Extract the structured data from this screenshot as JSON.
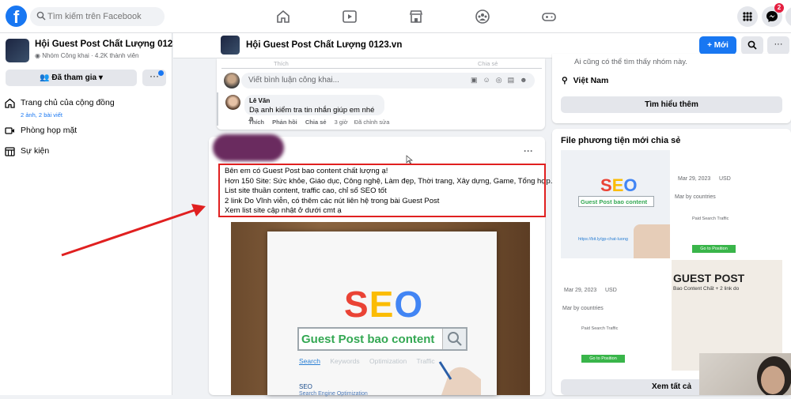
{
  "topbar": {
    "logo": "f",
    "search_placeholder": "Tìm kiếm trên Facebook",
    "nav_icons": [
      "home-icon",
      "video-icon",
      "marketplace-icon",
      "groups-icon",
      "gaming-icon"
    ],
    "menu_icon": "grid-menu-icon",
    "messenger_icon": "messenger-icon",
    "notification_count": "2"
  },
  "left": {
    "group_name": "Hội Guest Post Chất Lượng 0123.vn",
    "group_meta": "Nhóm Công khai · 4.2K thành viên",
    "joined_label": "Đã tham gia",
    "more_label": "···",
    "nav": [
      {
        "label": "Trang chủ của cộng đồng",
        "sub": "2 ảnh, 2 bài viết"
      },
      {
        "label": "Phòng họp mặt",
        "sub": ""
      },
      {
        "label": "Sự kiện",
        "sub": ""
      }
    ]
  },
  "header": {
    "title": "Hội Guest Post Chất Lượng 0123.vn",
    "new_button": "Mới",
    "search_icon": "search-icon",
    "more_label": "···"
  },
  "comments": {
    "ghost_left": "Thích",
    "ghost_right": "Chia sẻ",
    "input_placeholder": "Viết bình luận công khai...",
    "author": "Lê Văn",
    "text": "Dạ anh kiểm tra tin nhắn giúp em nhé ạ",
    "actions": [
      "Thích",
      "Phản hồi",
      "Chia sẻ",
      "3 giờ",
      "Đã chỉnh sửa"
    ]
  },
  "post": {
    "lines": [
      "Bên em có Guest Post bao content chất lượng ạ!",
      "Hơn 150 Site: Sức khỏe, Giáo dục, Công nghệ, Làm đẹp, Thời trang, Xây dựng, Game, Tổng hợp...",
      "List site thuần content, traffic cao, chỉ số SEO tốt",
      "2 link Do Vĩnh viễn, có thêm các nút liên hệ trong bài Guest Post",
      "Xem list site cập nhật ở dưới cmt ạ"
    ],
    "image": {
      "seo_letters": [
        {
          "ch": "S",
          "color": "#ea4335"
        },
        {
          "ch": "E",
          "color": "#fbbc05"
        },
        {
          "ch": "O",
          "color": "#4285f4"
        }
      ],
      "search_text": "Guest Post bao content",
      "tabs": [
        "Search",
        "Keywords",
        "Optimization",
        "Traffic"
      ],
      "small_title": "SEO",
      "small_sub": "Search Engine Optimization"
    }
  },
  "right": {
    "about_text": "Ai cũng có thể tìm thấy nhóm này.",
    "location": "Việt Nam",
    "learn_more": "Tìm hiểu thêm",
    "media_title": "File phương tiện mới chia sẻ",
    "media": [
      {
        "seo": "SEO",
        "search": "Guest Post bao content",
        "url": "https://bit.ly/gp-chat-luong"
      },
      {
        "date": "Mar 29, 2023",
        "currency": "USD",
        "countries": "Mar by countries",
        "paid": "Paid Search Traffic",
        "btn": "Go to Position Tracking"
      },
      {
        "date": "Mar 29, 2023",
        "currency": "USD",
        "countries": "Mar by countries",
        "paid": "Paid Search Traffic",
        "btn": "Go to Position Tracking"
      },
      {
        "title": "GUEST POST",
        "sub": "Bao Content Chất + 2 link do"
      }
    ],
    "see_all": "Xem tất cả"
  }
}
